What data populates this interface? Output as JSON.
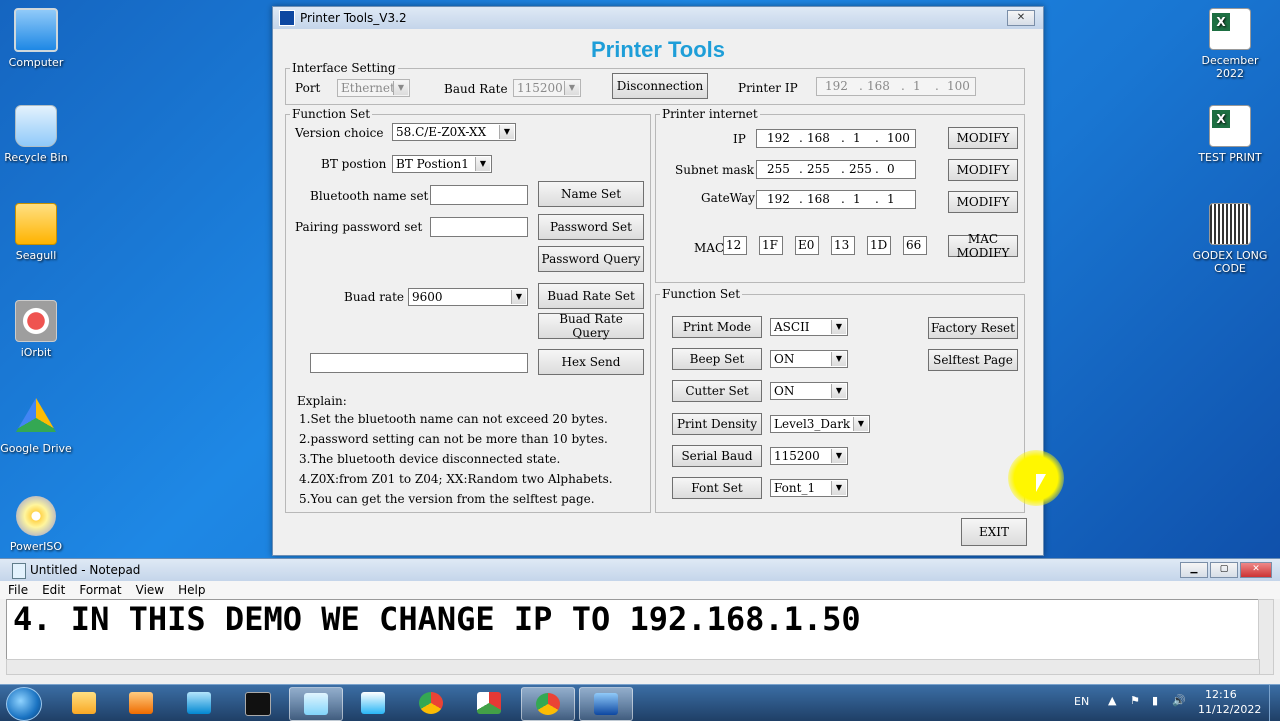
{
  "desktop": {
    "left_icons": [
      {
        "label": "Computer",
        "icon": "computer-icon"
      },
      {
        "label": "Recycle Bin",
        "icon": "recycle-bin-icon"
      },
      {
        "label": "Seagull",
        "icon": "folder-icon"
      },
      {
        "label": "iOrbit",
        "icon": "iorbit-icon"
      },
      {
        "label": "Google Drive",
        "icon": "google-drive-icon"
      },
      {
        "label": "PowerISO",
        "icon": "poweriso-icon"
      }
    ],
    "right_icons": [
      {
        "label": "December 2022",
        "icon": "excel-icon"
      },
      {
        "label": "TEST PRINT",
        "icon": "excel-icon"
      },
      {
        "label": "GODEX LONG CODE",
        "icon": "barcode-icon"
      }
    ]
  },
  "printer_tools": {
    "window_title": "Printer Tools_V3.2",
    "close_glyph": "✕",
    "title": "Printer Tools",
    "interface": {
      "legend": "Interface Setting",
      "port_label": "Port",
      "port_value": "Ethernet",
      "baud_label": "Baud Rate",
      "baud_value": "115200",
      "disconnect_button": "Disconnection",
      "printer_ip_label": "Printer IP",
      "printer_ip": [
        "192",
        "168",
        "1",
        "100"
      ]
    },
    "function_set_left": {
      "legend": "Function Set",
      "version_label": "Version choice",
      "version_value": "58.C/E-Z0X-XX",
      "bt_position_label": "BT postion",
      "bt_position_value": "BT Postion1",
      "bt_name_label": "Bluetooth name set",
      "bt_name_value": "",
      "name_set_button": "Name Set",
      "pairing_label": "Pairing password set",
      "pairing_value": "",
      "password_set_button": "Password Set",
      "password_query_button": "Password Query",
      "baud_label": "Buad rate",
      "baud_value": "9600",
      "baud_set_button": "Buad Rate Set",
      "baud_query_button": "Buad Rate Query",
      "hex_value": "",
      "hex_send_button": "Hex Send",
      "explain_title": "Explain:",
      "explain_lines": [
        "1.Set the bluetooth name can not exceed 20 bytes.",
        "2.password setting can not be more than 10 bytes.",
        "3.The bluetooth device disconnected state.",
        "4.Z0X:from Z01 to Z04; XX:Random two Alphabets.",
        "5.You can get the version from the selftest page."
      ]
    },
    "printer_internet": {
      "legend": "Printer internet",
      "ip_label": "IP",
      "ip": [
        "192",
        "168",
        "1",
        "100"
      ],
      "subnet_label": "Subnet mask",
      "subnet": [
        "255",
        "255",
        "255",
        "0"
      ],
      "gateway_label": "GateWay",
      "gateway": [
        "192",
        "168",
        "1",
        "1"
      ],
      "modify_button": "MODIFY",
      "mac_label": "MAC",
      "mac": [
        "12",
        "1F",
        "E0",
        "13",
        "1D",
        "66"
      ],
      "mac_modify_button": "MAC MODIFY"
    },
    "function_set_right": {
      "legend": "Function Set",
      "print_mode_button": "Print Mode",
      "print_mode_value": "ASCII",
      "beep_button": "Beep Set",
      "beep_value": "ON",
      "cutter_button": "Cutter Set",
      "cutter_value": "ON",
      "density_button": "Print Density",
      "density_value": "Level3_Dark",
      "serial_baud_button": "Serial Baud",
      "serial_baud_value": "115200",
      "font_button": "Font Set",
      "font_value": "Font_1",
      "factory_reset_button": "Factory Reset",
      "selftest_button": "Selftest Page"
    },
    "exit_button": "EXIT"
  },
  "notepad": {
    "title": "Untitled - Notepad",
    "menu": [
      "File",
      "Edit",
      "Format",
      "View",
      "Help"
    ],
    "text": "4. IN THIS DEMO WE CHANGE IP TO 192.168.1.50"
  },
  "taskbar": {
    "language": "EN",
    "time": "12:16",
    "date": "11/12/2022"
  },
  "colors": {
    "title_blue": "#1e9ed8",
    "desktop_blue": "#1976d2"
  }
}
